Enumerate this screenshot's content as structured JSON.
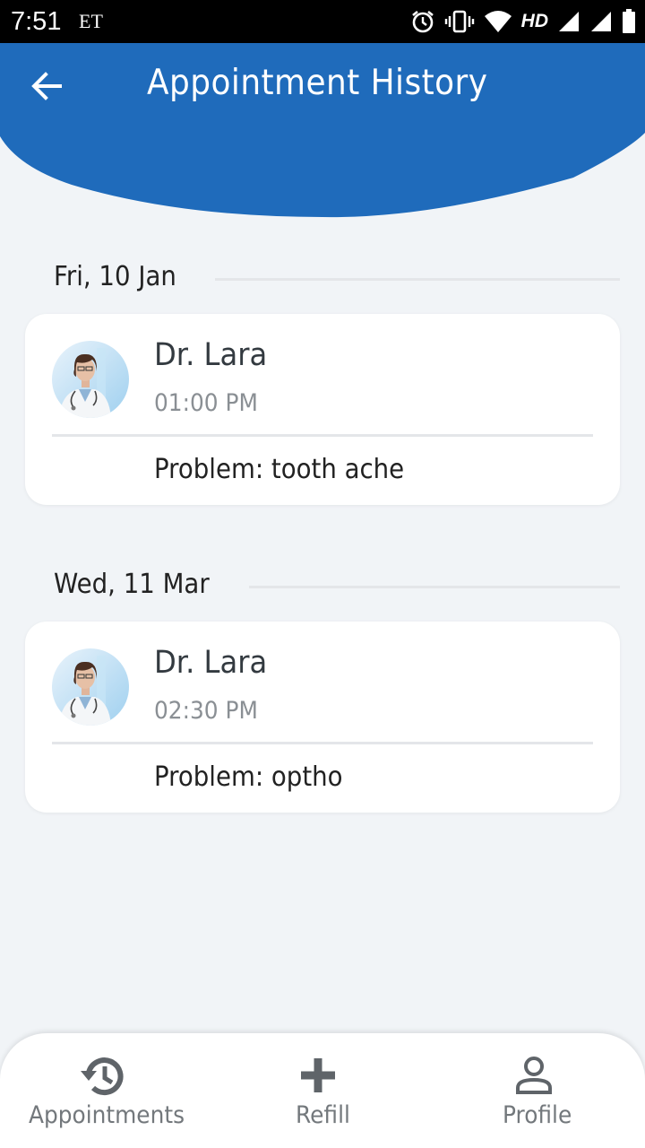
{
  "status_bar": {
    "time": "7:51",
    "carrier": "ET",
    "network": "HD",
    "icons": [
      "alarm-icon",
      "vibrate-icon",
      "wifi-icon",
      "signal-icon",
      "signal-icon",
      "battery-icon"
    ]
  },
  "header": {
    "title": "Appointment History",
    "back_icon": "arrow-left-icon",
    "color": "#1f6bbb"
  },
  "appointments": [
    {
      "date": "Fri, 10 Jan",
      "doctor": "Dr. Lara",
      "time": "01:00 PM",
      "problem": "Problem: tooth ache"
    },
    {
      "date": "Wed, 11 Mar",
      "doctor": "Dr. Lara",
      "time": "02:30 PM",
      "problem": "Problem: optho"
    }
  ],
  "bottom_nav": {
    "items": [
      {
        "label": "Appointments",
        "icon": "history-icon"
      },
      {
        "label": "Refill",
        "icon": "plus-icon"
      },
      {
        "label": "Profile",
        "icon": "person-icon"
      }
    ]
  }
}
